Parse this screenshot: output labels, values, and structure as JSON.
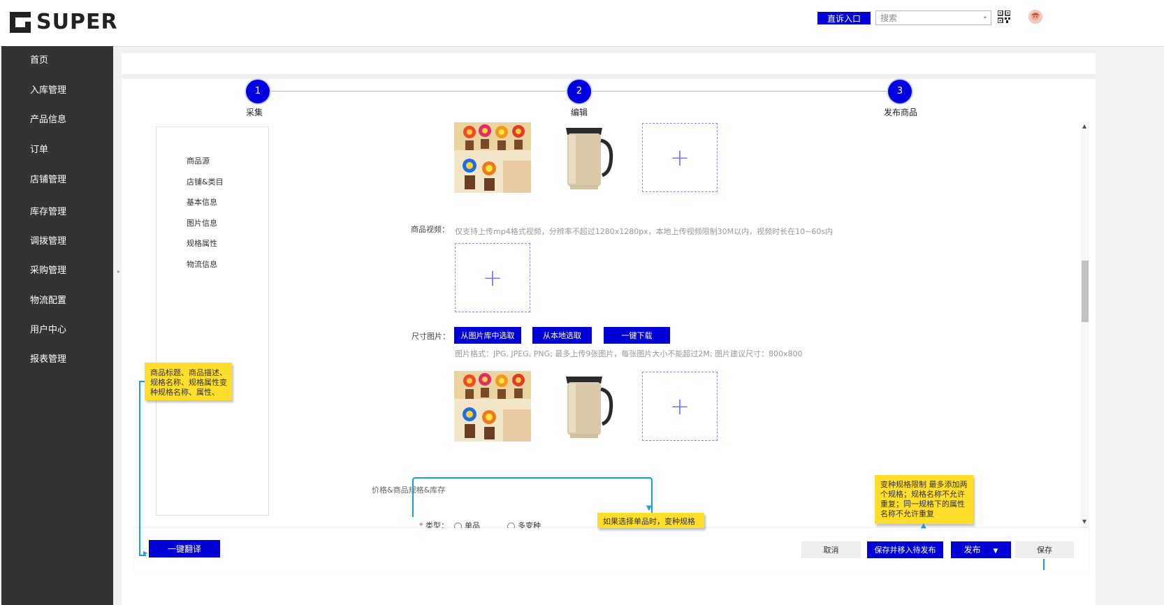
{
  "header": {
    "logo_text": "SUPER",
    "complain_label": "直诉入口",
    "search_placeholder": "搜索"
  },
  "sidebar": {
    "items": [
      {
        "label": "首页"
      },
      {
        "label": "入库管理"
      },
      {
        "label": "产品信息"
      },
      {
        "label": "订单"
      },
      {
        "label": "店铺管理"
      },
      {
        "label": "库存管理"
      },
      {
        "label": "调拨管理"
      },
      {
        "label": "采购管理"
      },
      {
        "label": "物流配置"
      },
      {
        "label": "用户中心"
      },
      {
        "label": "报表管理"
      }
    ]
  },
  "steps": [
    {
      "number": "1",
      "label": "采集"
    },
    {
      "number": "2",
      "label": "编辑"
    },
    {
      "number": "3",
      "label": "发布商品"
    }
  ],
  "anchors": [
    "商品源",
    "店铺&类目",
    "基本信息",
    "图片信息",
    "规格属性",
    "物流信息"
  ],
  "form": {
    "video_label": "商品视频：",
    "video_hint": "仅支持上传mp4格式视频，分辨率不超过1280x1280px，本地上传视频限制30M以内，视频时长在10~60s内",
    "size_label": "尺寸图片：",
    "btn_from_library": "从图片库中选取",
    "btn_from_local": "从本地选取",
    "btn_download": "一键下载",
    "size_hint": "图片格式：JPG, JPEG, PNG; 最多上传9张图片，每张图片大小不能超过2M; 图片建议尺寸：800x800",
    "section_price": "价格&商品规格&库存",
    "type_label": "类型：",
    "type_required": "*",
    "type_options": [
      "单品",
      "多变种"
    ],
    "upload_plus": "+"
  },
  "notes": {
    "translate_fields": "商品标题、商品描述、规格名称、规格属性变种规格名称、属性、",
    "single_hint": "如果选择单品时，变种规格",
    "variant_limit": "变种规格限制  最多添加两个规格；规格名称不允许重复；同一规格下的属性名称不允许重复"
  },
  "footer": {
    "translate_btn": "一键翻译",
    "cancel": "取消",
    "save_publish": "保存并移入待发布",
    "publish": "发布",
    "save": "保存"
  },
  "colors": {
    "accent": "#0000d6",
    "sidebar_bg": "#333333",
    "note_yellow": "#ffde2b",
    "connector": "#1a9ce0"
  }
}
